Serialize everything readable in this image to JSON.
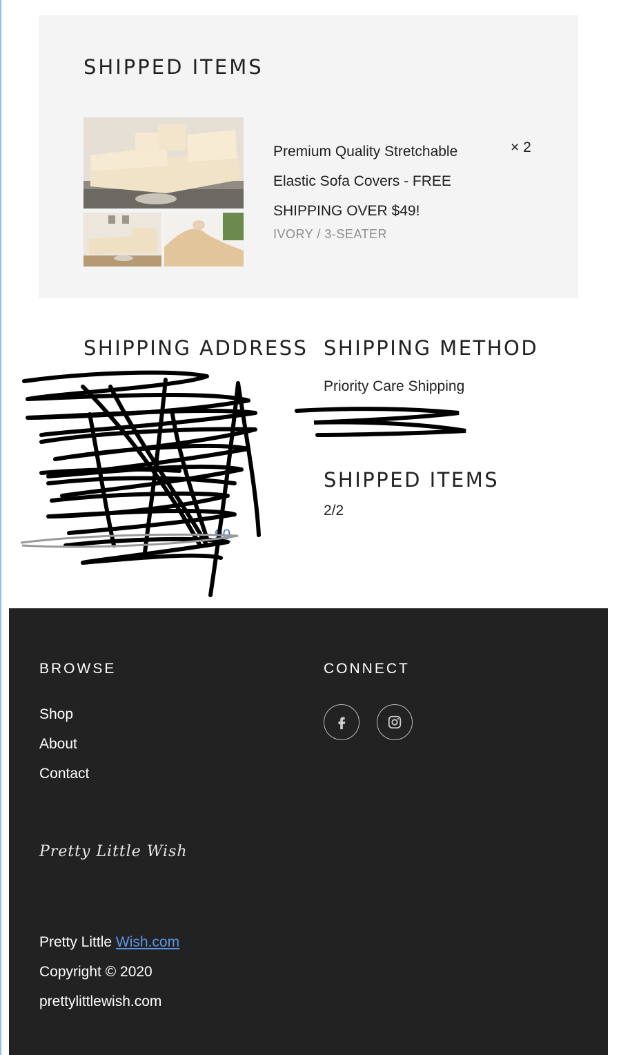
{
  "shipped_items_card": {
    "title": "SHIPPED ITEMS",
    "product": {
      "name_line1": "Premium Quality Stretchable",
      "name_line2": "Elastic Sofa Covers - FREE",
      "name_line3": "SHIPPING OVER $49!",
      "variant": "IVORY / 3-SEATER",
      "quantity": "× 2"
    }
  },
  "shipping_address": {
    "title": "SHIPPING ADDRESS",
    "phone_tail": "90"
  },
  "shipping_method": {
    "title": "SHIPPING METHOD",
    "name": "Priority Care Shipping"
  },
  "shipped_items_summary": {
    "title": "SHIPPED ITEMS",
    "count": "2/2"
  },
  "footer": {
    "browse_title": "BROWSE",
    "links": [
      "Shop",
      "About",
      "Contact"
    ],
    "connect_title": "CONNECT",
    "social": [
      "facebook-icon",
      "instagram-icon"
    ],
    "logo_text": "Pretty Little Wish",
    "brand_prefix": "Pretty Little ",
    "brand_link": "Wish.com",
    "copyright": "Copyright © 2020",
    "domain": "prettylittlewish.com"
  },
  "colors": {
    "card_bg": "#f4f4f4",
    "footer_bg": "#222223",
    "link_blue": "#5c95e8",
    "variant_gray": "#8c8c8c"
  }
}
